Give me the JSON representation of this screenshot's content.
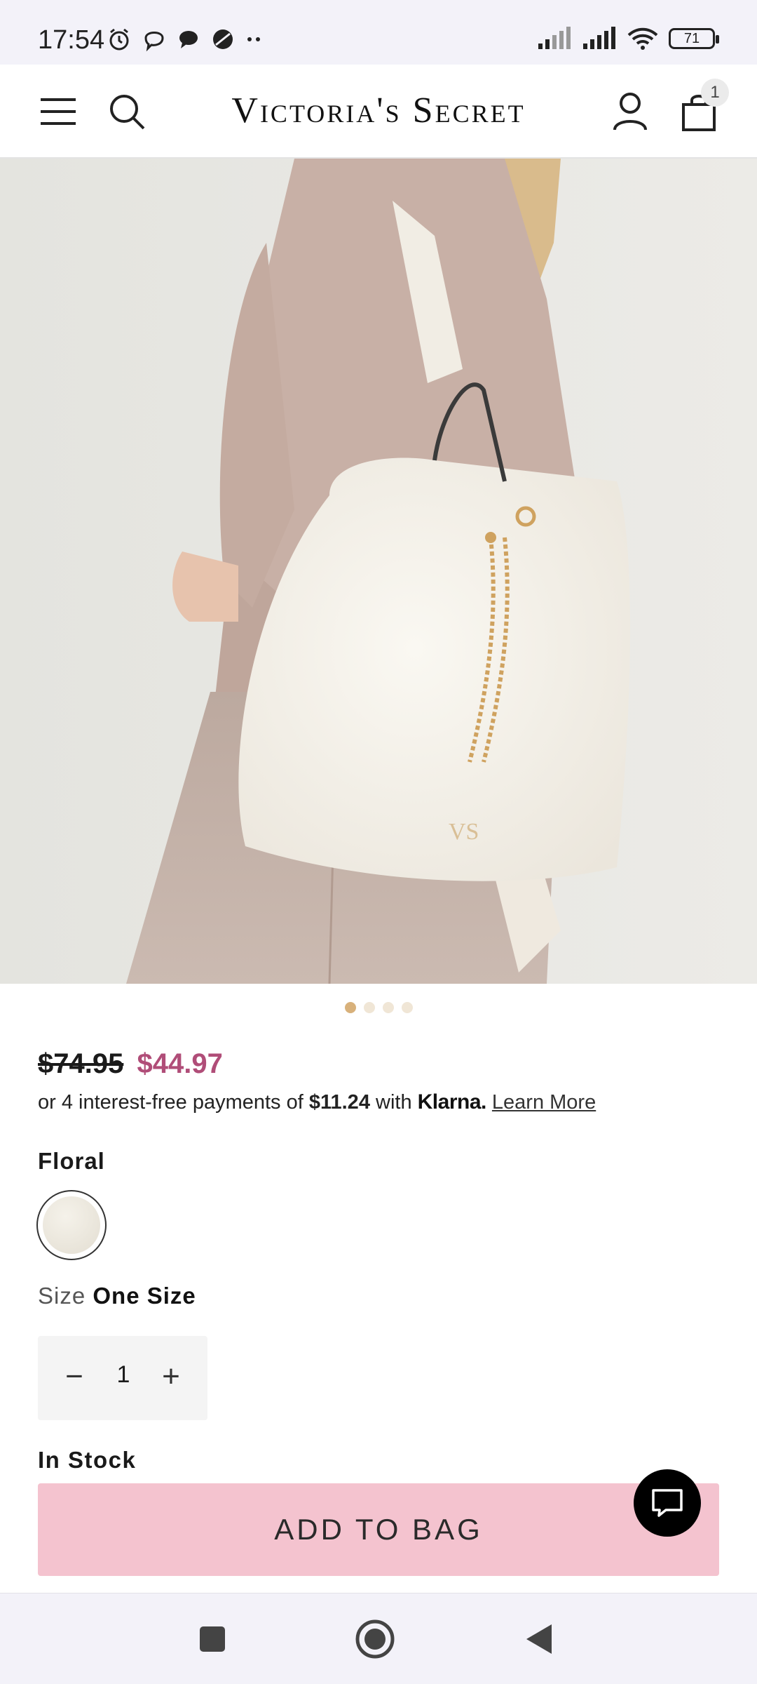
{
  "status_bar": {
    "time": "17:54",
    "battery": "71",
    "icons": [
      "alarm-icon",
      "viber-icon",
      "chat-bubble-icon",
      "app-icon",
      "more-dots-icon",
      "signal-icon",
      "signal-icon",
      "wifi-icon",
      "battery-icon"
    ]
  },
  "header": {
    "brand": "Victoria's Secret",
    "bag_count": "1",
    "icons": [
      "menu-icon",
      "search-icon",
      "account-icon",
      "shopping-bag-icon"
    ]
  },
  "gallery": {
    "image_count": 4,
    "active_index": 0
  },
  "product": {
    "old_price": "$74.95",
    "sale_price": "$44.97",
    "klarna": {
      "prefix": "or 4 interest-free payments of ",
      "amount": "$11.24",
      "middle": " with ",
      "logo": "Klarna.",
      "learn_more": "Learn More"
    },
    "color_label": "Floral",
    "size_label": "Size",
    "size_value": "One Size",
    "quantity": "1",
    "quantity_minus": "−",
    "quantity_plus": "+",
    "stock": "In Stock",
    "add_to_bag": "ADD TO BAG"
  },
  "colors": {
    "sale": "#b04d78",
    "cta": "#f4c3cf",
    "dot_active": "#d8b17b"
  },
  "nav_bar": {
    "icons": [
      "recent-apps-icon",
      "home-icon",
      "back-icon"
    ]
  }
}
